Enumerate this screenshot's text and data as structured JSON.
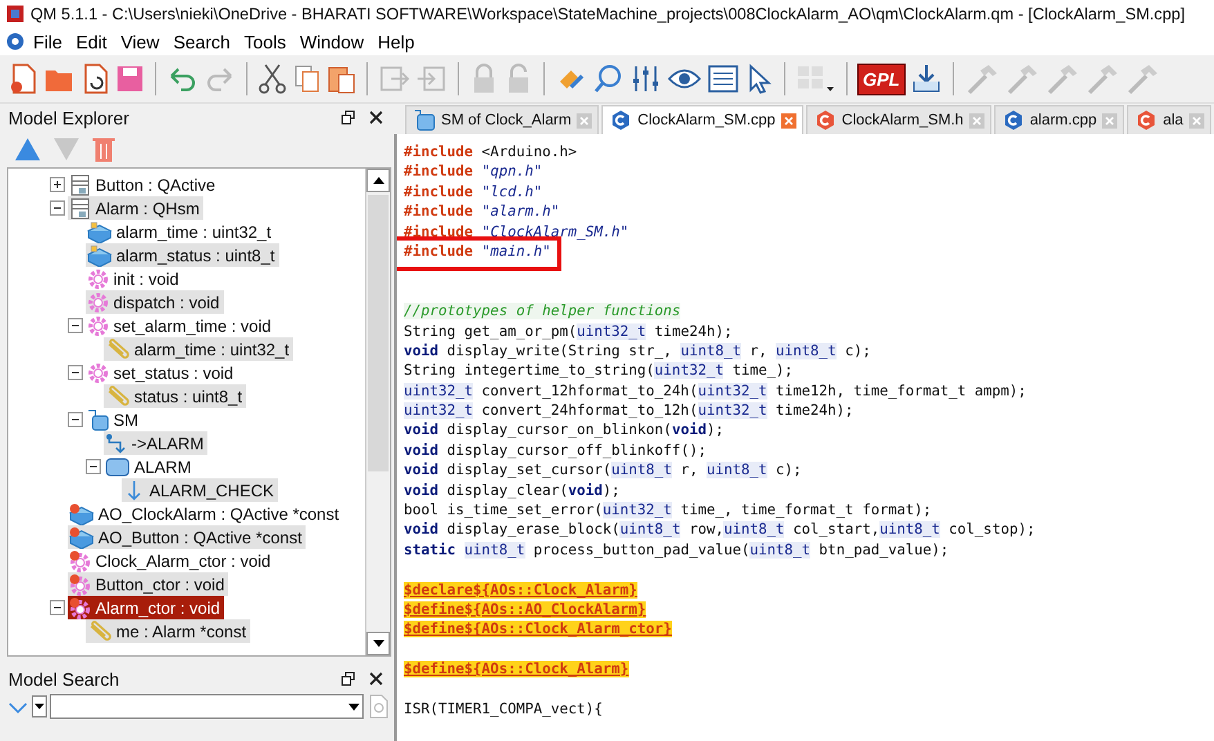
{
  "window": {
    "title": "QM 5.1.1 - C:\\Users\\nieki\\OneDrive - BHARATI SOFTWARE\\Workspace\\StateMachine_projects\\008ClockAlarm_AO\\qm\\ClockAlarm.qm - [ClockAlarm_SM.cpp]"
  },
  "menu": [
    "File",
    "Edit",
    "View",
    "Search",
    "Tools",
    "Window",
    "Help"
  ],
  "toolbar": {
    "badge": "GPL"
  },
  "model_explorer": {
    "title": "Model Explorer",
    "tree": [
      {
        "label": "Button : QActive",
        "kind": "class",
        "expanded": false,
        "selected": false
      },
      {
        "label": "Alarm : QHsm",
        "kind": "class",
        "expanded": true,
        "selected": false,
        "children": [
          {
            "label": "alarm_time : uint32_t",
            "kind": "attribute",
            "selected": false
          },
          {
            "label": "alarm_status : uint8_t",
            "kind": "attribute",
            "selected": false
          },
          {
            "label": "init : void",
            "kind": "operation",
            "selected": false
          },
          {
            "label": "dispatch : void",
            "kind": "operation",
            "selected": false
          },
          {
            "label": "set_alarm_time : void",
            "kind": "operation",
            "expanded": true,
            "selected": false,
            "children": [
              {
                "label": "alarm_time : uint32_t",
                "kind": "parameter",
                "selected": false
              }
            ]
          },
          {
            "label": "set_status : void",
            "kind": "operation",
            "expanded": true,
            "selected": false,
            "children": [
              {
                "label": "status : uint8_t",
                "kind": "parameter",
                "selected": false
              }
            ]
          },
          {
            "label": "SM",
            "kind": "statemachine",
            "expanded": true,
            "selected": false,
            "children": [
              {
                "label": "->ALARM",
                "kind": "initial",
                "selected": false
              },
              {
                "label": "ALARM",
                "kind": "state",
                "expanded": true,
                "selected": false,
                "children": [
                  {
                    "label": "ALARM_CHECK",
                    "kind": "transition",
                    "selected": false
                  }
                ]
              }
            ]
          }
        ]
      },
      {
        "label": "AO_ClockAlarm : QActive *const",
        "kind": "global_attribute",
        "selected": false
      },
      {
        "label": "AO_Button : QActive *const",
        "kind": "global_attribute",
        "selected": false
      },
      {
        "label": "Clock_Alarm_ctor : void",
        "kind": "free_operation",
        "selected": false
      },
      {
        "label": "Button_ctor : void",
        "kind": "free_operation",
        "selected": false
      },
      {
        "label": "Alarm_ctor : void",
        "kind": "free_operation",
        "expanded": true,
        "selected": true,
        "children": [
          {
            "label": "me : Alarm *const",
            "kind": "parameter",
            "selected": false
          }
        ]
      }
    ]
  },
  "model_search": {
    "title": "Model Search"
  },
  "tabs": [
    {
      "label": "SM of Clock_Alarm",
      "kind": "diagram",
      "selected": false
    },
    {
      "label": "ClockAlarm_SM.cpp",
      "kind": "cpp",
      "selected": true
    },
    {
      "label": "ClockAlarm_SM.h",
      "kind": "header",
      "selected": false
    },
    {
      "label": "alarm.cpp",
      "kind": "cpp",
      "selected": false
    },
    {
      "label": "ala",
      "kind": "header",
      "selected": false
    }
  ],
  "code": [
    {
      "kind": "code",
      "segments": [
        {
          "kind": "pre",
          "text": "#include"
        },
        {
          "kind": "plain",
          "text": " <Arduino.h>"
        }
      ]
    },
    {
      "kind": "code",
      "segments": [
        {
          "kind": "pre",
          "text": "#include "
        },
        {
          "kind": "str",
          "text": "\"qpn.h\""
        }
      ]
    },
    {
      "kind": "code",
      "segments": [
        {
          "kind": "pre",
          "text": "#include "
        },
        {
          "kind": "str",
          "text": "\"lcd.h\""
        }
      ]
    },
    {
      "kind": "code",
      "segments": [
        {
          "kind": "pre",
          "text": "#include "
        },
        {
          "kind": "str",
          "text": "\"alarm.h\""
        }
      ]
    },
    {
      "kind": "code",
      "segments": [
        {
          "kind": "pre",
          "text": "#include "
        },
        {
          "kind": "str",
          "text": "\"ClockAlarm_SM.h\""
        }
      ]
    },
    {
      "kind": "code",
      "boxed": true,
      "segments": [
        {
          "kind": "pre",
          "text": "#include "
        },
        {
          "kind": "str",
          "text": "\"main.h\""
        }
      ]
    },
    {
      "kind": "blank"
    },
    {
      "kind": "blank"
    },
    {
      "kind": "code",
      "segments": [
        {
          "kind": "comment",
          "text": "//prototypes of helper functions"
        }
      ]
    },
    {
      "kind": "code",
      "segments": [
        {
          "kind": "plain",
          "text": "String get_am_or_pm("
        },
        {
          "kind": "type",
          "text": "uint32_t"
        },
        {
          "kind": "plain",
          "text": " time24h);"
        }
      ]
    },
    {
      "kind": "code",
      "segments": [
        {
          "kind": "kw",
          "text": "void"
        },
        {
          "kind": "plain",
          "text": " display_write(String str_, "
        },
        {
          "kind": "type",
          "text": "uint8_t"
        },
        {
          "kind": "plain",
          "text": " r, "
        },
        {
          "kind": "type",
          "text": "uint8_t"
        },
        {
          "kind": "plain",
          "text": " c);"
        }
      ]
    },
    {
      "kind": "code",
      "segments": [
        {
          "kind": "plain",
          "text": "String integertime_to_string("
        },
        {
          "kind": "type",
          "text": "uint32_t"
        },
        {
          "kind": "plain",
          "text": " time_);"
        }
      ]
    },
    {
      "kind": "code",
      "segments": [
        {
          "kind": "type",
          "text": "uint32_t"
        },
        {
          "kind": "plain",
          "text": " convert_12hformat_to_24h("
        },
        {
          "kind": "type",
          "text": "uint32_t"
        },
        {
          "kind": "plain",
          "text": " time12h, time_format_t ampm);"
        }
      ]
    },
    {
      "kind": "code",
      "segments": [
        {
          "kind": "type",
          "text": "uint32_t"
        },
        {
          "kind": "plain",
          "text": " convert_24hformat_to_12h("
        },
        {
          "kind": "type",
          "text": "uint32_t"
        },
        {
          "kind": "plain",
          "text": " time24h);"
        }
      ]
    },
    {
      "kind": "code",
      "segments": [
        {
          "kind": "kw",
          "text": "void"
        },
        {
          "kind": "plain",
          "text": " display_cursor_on_blinkon("
        },
        {
          "kind": "kw",
          "text": "void"
        },
        {
          "kind": "plain",
          "text": ");"
        }
      ]
    },
    {
      "kind": "code",
      "segments": [
        {
          "kind": "kw",
          "text": "void"
        },
        {
          "kind": "plain",
          "text": " display_cursor_off_blinkoff();"
        }
      ]
    },
    {
      "kind": "code",
      "segments": [
        {
          "kind": "kw",
          "text": "void"
        },
        {
          "kind": "plain",
          "text": " display_set_cursor("
        },
        {
          "kind": "type",
          "text": "uint8_t"
        },
        {
          "kind": "plain",
          "text": " r, "
        },
        {
          "kind": "type",
          "text": "uint8_t"
        },
        {
          "kind": "plain",
          "text": " c);"
        }
      ]
    },
    {
      "kind": "code",
      "segments": [
        {
          "kind": "kw",
          "text": "void"
        },
        {
          "kind": "plain",
          "text": " display_clear("
        },
        {
          "kind": "kw",
          "text": "void"
        },
        {
          "kind": "plain",
          "text": ");"
        }
      ]
    },
    {
      "kind": "code",
      "segments": [
        {
          "kind": "plain",
          "text": "bool is_time_set_error("
        },
        {
          "kind": "type",
          "text": "uint32_t"
        },
        {
          "kind": "plain",
          "text": " time_, time_format_t format);"
        }
      ]
    },
    {
      "kind": "code",
      "segments": [
        {
          "kind": "kw",
          "text": "void"
        },
        {
          "kind": "plain",
          "text": " display_erase_block("
        },
        {
          "kind": "type",
          "text": "uint8_t"
        },
        {
          "kind": "plain",
          "text": " row,"
        },
        {
          "kind": "type",
          "text": "uint8_t"
        },
        {
          "kind": "plain",
          "text": " col_start,"
        },
        {
          "kind": "type",
          "text": "uint8_t"
        },
        {
          "kind": "plain",
          "text": " col_stop);"
        }
      ]
    },
    {
      "kind": "code",
      "segments": [
        {
          "kind": "kw",
          "text": "static "
        },
        {
          "kind": "type",
          "text": "uint8_t"
        },
        {
          "kind": "plain",
          "text": " process_button_pad_value("
        },
        {
          "kind": "type",
          "text": "uint8_t"
        },
        {
          "kind": "plain",
          "text": " btn_pad_value);"
        }
      ]
    },
    {
      "kind": "blank"
    },
    {
      "kind": "code",
      "segments": [
        {
          "kind": "macro",
          "text": "$declare${AOs::Clock_Alarm}"
        }
      ]
    },
    {
      "kind": "code",
      "segments": [
        {
          "kind": "macro",
          "text": "$define${AOs::AO_ClockAlarm}"
        }
      ]
    },
    {
      "kind": "code",
      "segments": [
        {
          "kind": "macro",
          "text": "$define${AOs::Clock_Alarm_ctor}"
        }
      ]
    },
    {
      "kind": "blank"
    },
    {
      "kind": "code",
      "segments": [
        {
          "kind": "macro",
          "text": "$define${AOs::Clock_Alarm}"
        }
      ]
    },
    {
      "kind": "blank"
    },
    {
      "kind": "code",
      "segments": [
        {
          "kind": "plain",
          "text": "ISR(TIMER1_COMPA_vect){"
        }
      ]
    }
  ]
}
